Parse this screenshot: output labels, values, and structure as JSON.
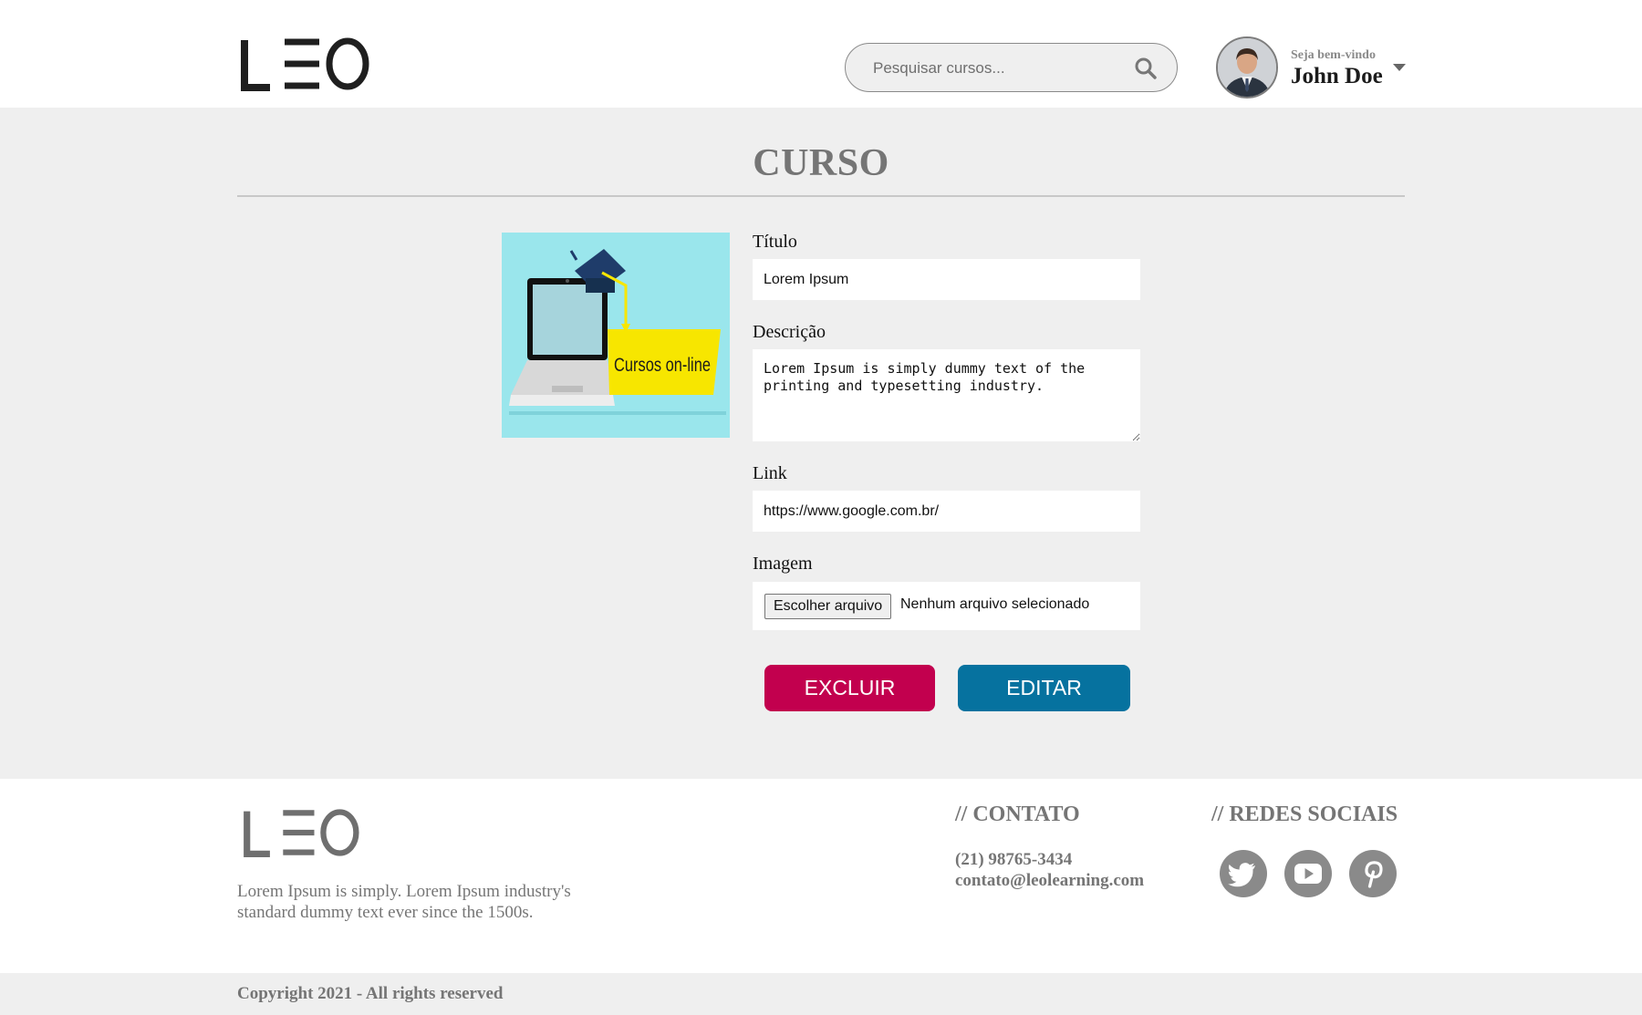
{
  "header": {
    "logo_text": "LEO",
    "search": {
      "placeholder": "Pesquisar cursos..."
    },
    "user": {
      "greeting": "Seja bem-vindo",
      "name": "John Doe"
    }
  },
  "main": {
    "title": "CURSO",
    "image": {
      "banner_text": "Cursos on-line"
    },
    "form": {
      "title_label": "Título",
      "title_value": "Lorem Ipsum",
      "description_label": "Descrição",
      "description_value": "Lorem Ipsum is simply dummy text of the printing and typesetting industry.",
      "link_label": "Link",
      "link_value": "https://www.google.com.br/",
      "image_label": "Imagem",
      "file_button": "Escolher arquivo",
      "file_status": "Nenhum arquivo selecionado"
    },
    "buttons": {
      "delete": "EXCLUIR",
      "edit": "EDITAR"
    }
  },
  "footer": {
    "logo_text": "LEO",
    "description": "Lorem Ipsum is simply. Lorem Ipsum industry's standard dummy text ever since the 1500s.",
    "contact_heading": "// CONTATO",
    "phone": "(21) 98765-3434",
    "email": "contato@leolearning.com",
    "social_heading": "// REDES SOCIAIS",
    "social": [
      "twitter-icon",
      "youtube-icon",
      "pinterest-icon"
    ],
    "copyright": "Copyright 2021 - All rights reserved"
  },
  "colors": {
    "delete": "#c2004e",
    "edit": "#06729f",
    "page_bg": "#efefef",
    "muted_text": "#757575"
  }
}
